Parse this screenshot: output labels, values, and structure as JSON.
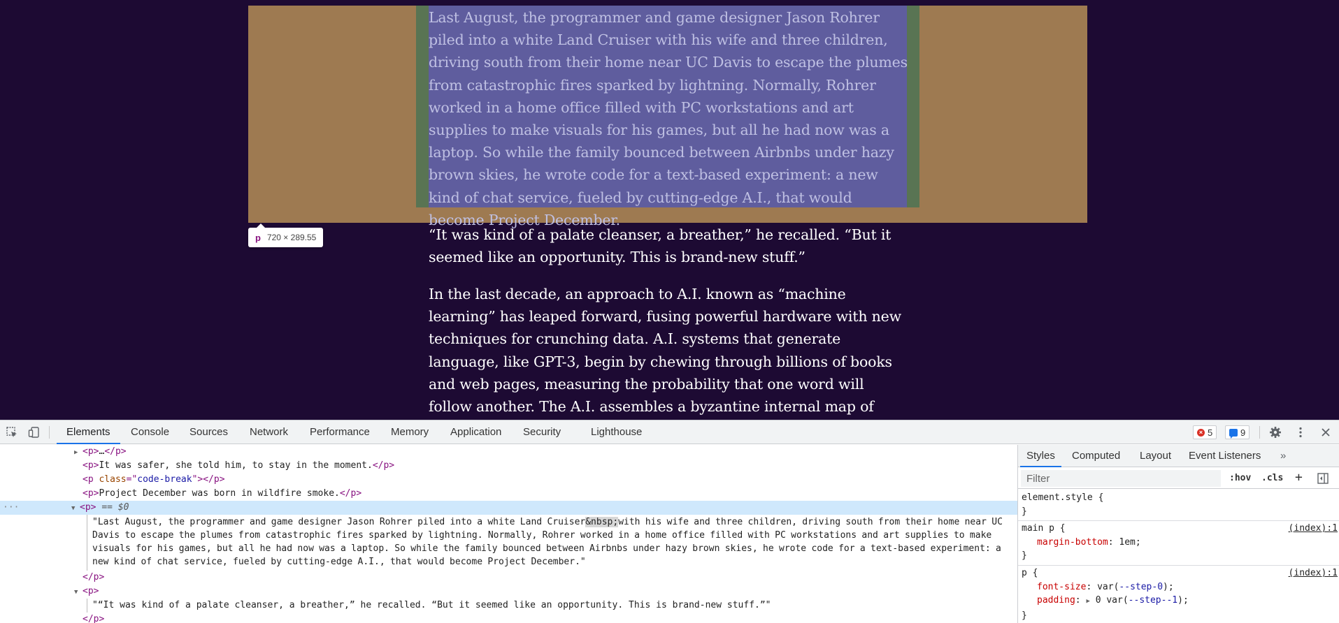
{
  "article": {
    "p1": "Last August, the programmer and game designer Jason Rohrer piled into a white Land Cruiser with his wife and three children, driving south from their home near UC Davis to escape the plumes from catastrophic fires sparked by lightning. Normally, Rohrer worked in a home office filled with PC workstations and art supplies to make visuals for his games, but all he had now was a laptop. So while the family bounced between Airbnbs under hazy brown skies, he wrote code for a text-based experiment: a new kind of chat service, fueled by cutting-edge A.I., that would become Project December.",
    "p2": "“It was kind of a palate cleanser, a breather,” he recalled. “But it seemed like an opportunity. This is brand-new stuff.”",
    "p3": "In the last decade, an approach to A.I. known as “machine learning” has leaped forward, fusing powerful hardware with new techniques for crunching data. A.I. systems that generate language, like GPT-3, begin by chewing through billions of books and web pages, measuring the probability that one word will follow another. The A.I. assembles a byzantine internal map of those probabilities."
  },
  "inspect_tooltip": {
    "tag": "p",
    "size": "720 × 289.55"
  },
  "devtools": {
    "tabs": [
      "Elements",
      "Console",
      "Sources",
      "Network",
      "Performance",
      "Memory",
      "Application",
      "Security",
      "Lighthouse"
    ],
    "errors": "5",
    "messages": "9",
    "dom": {
      "row1_ellipsis": "…",
      "row2_text": "It was safer, she told him, to stay in the moment.",
      "row3_attr_name": "class",
      "row3_attr_value": "code-break",
      "row4_text": "Project December was born in wildfire smoke.",
      "selected_marker": "== $0",
      "text_before_nbsp": "\"Last August, the programmer and game designer Jason Rohrer piled into a white Land Cruiser",
      "nbsp": "&nbsp;",
      "text_after_nbsp": "with his wife and three children, driving south from their home near UC Davis to escape the plumes from catastrophic fires sparked by lightning. Normally, Rohrer worked in a home office filled with PC workstations and art supplies to make visuals for his games, but all he had now was a laptop. So while the family bounced between Airbnbs under hazy brown skies, he wrote code for a text-based experiment: a new kind of chat service, fueled by cutting-edge A.I., that would become Project December.\"",
      "next_text": "\"“It was kind of a palate cleanser, a breather,” he recalled. “But it seemed like an opportunity. This is brand-new stuff.”\""
    },
    "styles": {
      "tabs": [
        "Styles",
        "Computed",
        "Layout",
        "Event Listeners"
      ],
      "filter_placeholder": "Filter",
      "hov": ":hov",
      "cls": ".cls",
      "rules": {
        "element_style": "element.style {",
        "main_p_selector": "main p {",
        "main_p_source": "(index):1",
        "margin_prop": "margin-bottom",
        "margin_val": "1em;",
        "p_selector": "p {",
        "p_source": "(index):1",
        "font_size_prop": "font-size",
        "font_size_val_pre": "var(",
        "font_size_var": "--step-0",
        "font_size_val_post": ");",
        "padding_prop": "padding",
        "padding_val_pre": "0 var(",
        "padding_var": "--step--1",
        "padding_val_post": ");"
      }
    }
  },
  "colors": {
    "page_bg": "#1d0a33",
    "margin_highlight": "#9e7a51",
    "padding_highlight": "#597453",
    "content_highlight": "#5f5d9e",
    "selection_blue": "#1a73e8"
  }
}
